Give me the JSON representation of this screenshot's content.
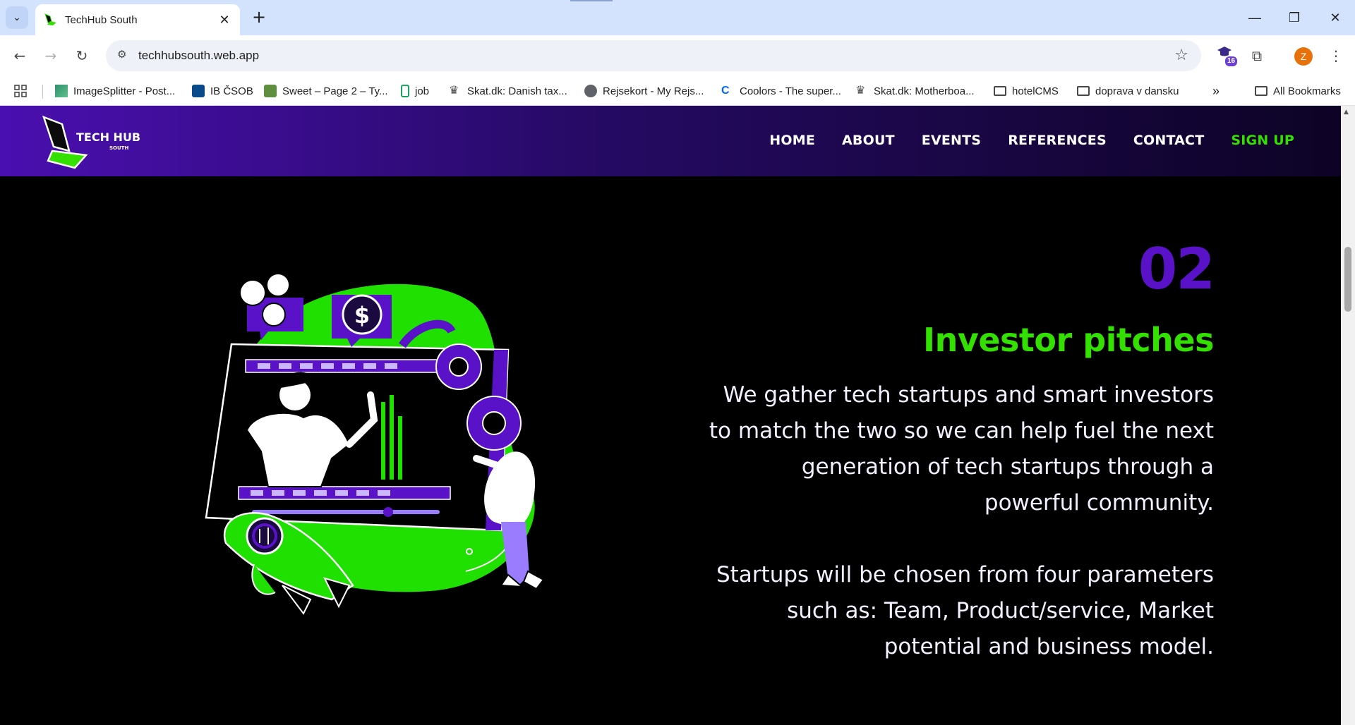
{
  "browser": {
    "tab_title": "TechHub South",
    "url": "techhubsouth.web.app",
    "extension_badge": "16",
    "profile_initial": "Z",
    "bookmarks": [
      {
        "label": "ImageSplitter - Post..."
      },
      {
        "label": "IB ČSOB"
      },
      {
        "label": "Sweet – Page 2 – Ty..."
      },
      {
        "label": "job"
      },
      {
        "label": "Skat.dk: Danish tax..."
      },
      {
        "label": "Rejsekort - My Rejs..."
      },
      {
        "label": "Coolors - The super..."
      },
      {
        "label": "Skat.dk: Motherboa..."
      },
      {
        "label": "hotelCMS"
      },
      {
        "label": "doprava v dansku"
      }
    ],
    "more_bookmarks": "»",
    "all_bookmarks": "All Bookmarks"
  },
  "site": {
    "logo_line1": "TECH HUB",
    "logo_line2": "SOUTH",
    "nav": {
      "home": "HOME",
      "about": "ABOUT",
      "events": "EVENTS",
      "references": "REFERENCES",
      "contact": "CONTACT",
      "signup": "SIGN UP"
    },
    "colors": {
      "accent_green": "#33e000",
      "accent_purple": "#5a12c8"
    }
  },
  "section": {
    "number": "02",
    "title": "Investor pitches",
    "paragraph1": "We gather tech startups and smart investors to match the two so we can help fuel the next generation of tech startups through a powerful community.",
    "paragraph2": "Startups will be chosen from four parameters such as: Team, Product/service, Market potential and business model.",
    "illustration_symbol": "$"
  }
}
